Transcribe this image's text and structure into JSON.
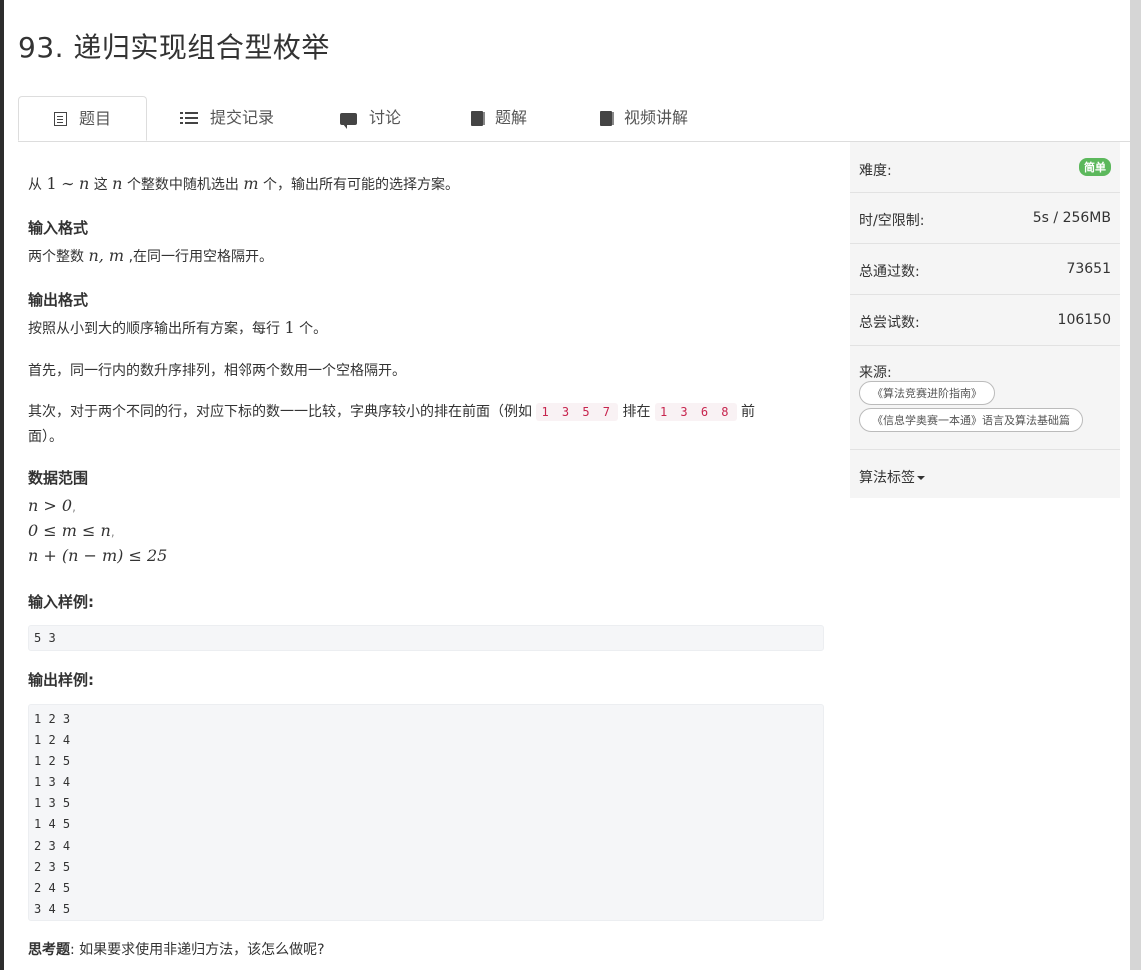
{
  "problem": {
    "title": "93. 递归实现组合型枚举"
  },
  "tabs": [
    {
      "label": "题目",
      "icon": "document-icon"
    },
    {
      "label": "提交记录",
      "icon": "list-icon"
    },
    {
      "label": "讨论",
      "icon": "chat-icon"
    },
    {
      "label": "题解",
      "icon": "book-icon"
    },
    {
      "label": "视频讲解",
      "icon": "book-icon"
    }
  ],
  "description": {
    "intro_1": "从",
    "intro_m1": "1",
    "intro_sim": "∼",
    "intro_n": "n",
    "intro_2": "这",
    "intro_n2": "n",
    "intro_3": "个整数中随机选出",
    "intro_m": "m",
    "intro_4": "个，输出所有可能的选择方案。"
  },
  "input_format": {
    "title": "输入格式",
    "text_1": "两个整数",
    "vars": "n, m",
    "text_2": ",在同一行用空格隔开。"
  },
  "output_format": {
    "title": "输出格式",
    "line1_a": "按照从小到大的顺序输出所有方案，每行",
    "line1_num": "1",
    "line1_b": "个。",
    "line2": "首先，同一行内的数升序排列，相邻两个数用一个空格隔开。",
    "line3_a": "其次，对于两个不同的行，对应下标的数一一比较，字典序较小的排在前面（例如",
    "code1": "1 3 5 7",
    "line3_b": "排在",
    "code2": "1 3 6 8",
    "line3_c": "前",
    "line3_d": "面）。"
  },
  "range": {
    "title": "数据范围",
    "c1": "n > 0",
    "c2": "0 ≤ m ≤ n",
    "c3": "n + (n − m) ≤ 25",
    "sep": ","
  },
  "sample_input": {
    "title": "输入样例:",
    "lines": [
      "5 3"
    ]
  },
  "sample_output": {
    "title": "输出样例:",
    "lines": [
      "1 2 3",
      "1 2 4",
      "1 2 5",
      "1 3 4",
      "1 3 5",
      "1 4 5",
      "2 3 4",
      "2 3 5",
      "2 4 5",
      "3 4 5"
    ]
  },
  "thinking": {
    "label": "思考题",
    "text": ": 如果要求使用非递归方法，该怎么做呢?"
  },
  "sidebar": {
    "difficulty_label": "难度:",
    "difficulty_value": "简单",
    "limit_label": "时/空限制:",
    "limit_value": "5s / 256MB",
    "passed_label": "总通过数:",
    "passed_value": "73651",
    "tried_label": "总尝试数:",
    "tried_value": "106150",
    "source_label": "来源:",
    "sources": [
      "《算法竞赛进阶指南》",
      "《信息学奥赛一本通》语言及算法基础篇"
    ],
    "tags_label": "算法标签"
  },
  "colors": {
    "difficulty_badge": "#5cb85c",
    "inline_code": "#c7254e"
  }
}
